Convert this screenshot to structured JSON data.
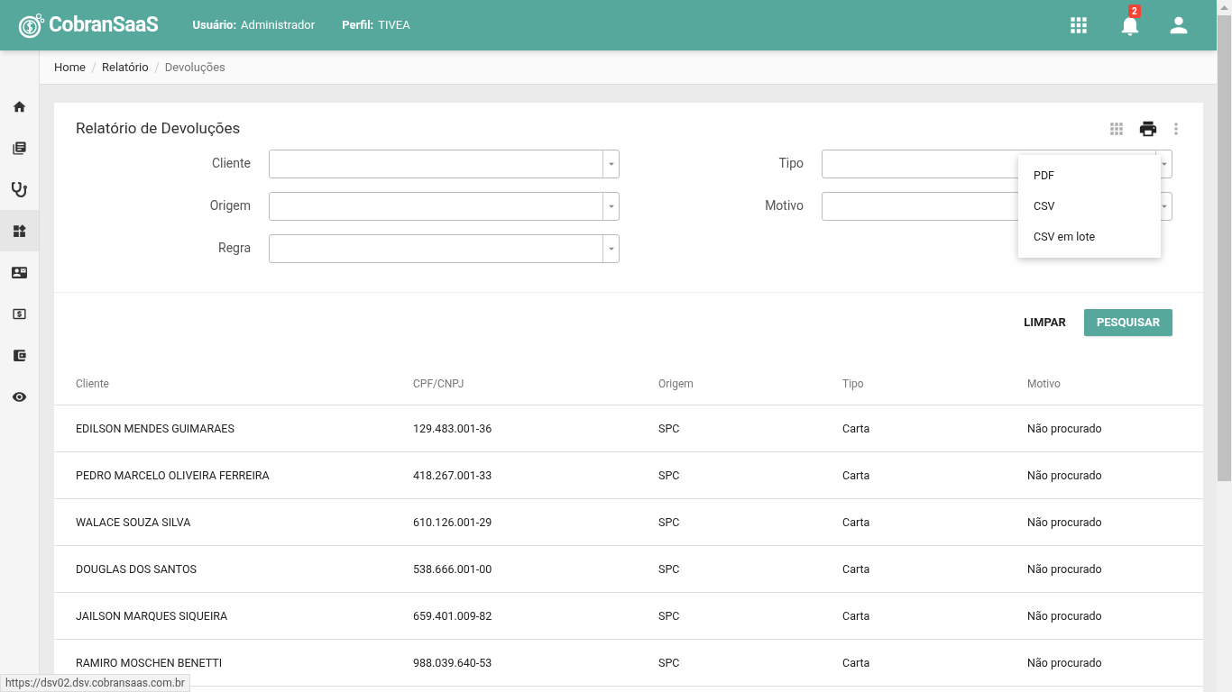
{
  "header": {
    "logo": "CobranSaaS",
    "user_label": "Usuário:",
    "user": "Administrador",
    "profile_label": "Perfil:",
    "profile": "TIVEA",
    "notifications": "2"
  },
  "sidebar": {
    "items": [
      {
        "selected": false
      },
      {
        "selected": false
      },
      {
        "selected": false
      },
      {
        "selected": true
      },
      {
        "selected": false
      },
      {
        "selected": false
      },
      {
        "selected": false
      },
      {
        "selected": false
      }
    ]
  },
  "breadcrumb": [
    "Home",
    "Relatório",
    "Devoluções"
  ],
  "card": {
    "title": "Relatório de Devoluções",
    "filters_left": [
      {
        "label": "Cliente"
      },
      {
        "label": "Origem"
      },
      {
        "label": "Regra"
      }
    ],
    "filters_right": [
      {
        "label": "Tipo"
      },
      {
        "label": "Motivo"
      }
    ],
    "export_menu": [
      "PDF",
      "CSV",
      "CSV em lote"
    ],
    "buttons": {
      "clear": "LIMPAR",
      "search": "PESQUISAR"
    },
    "table": {
      "columns": [
        "Cliente",
        "CPF/CNPJ",
        "Origem",
        "Tipo",
        "Motivo"
      ],
      "rows": [
        [
          "EDILSON MENDES GUIMARAES",
          "129.483.001-36",
          "SPC",
          "Carta",
          "Não procurado"
        ],
        [
          "PEDRO MARCELO OLIVEIRA FERREIRA",
          "418.267.001-33",
          "SPC",
          "Carta",
          "Não procurado"
        ],
        [
          "WALACE SOUZA SILVA",
          "610.126.001-29",
          "SPC",
          "Carta",
          "Não procurado"
        ],
        [
          "DOUGLAS DOS SANTOS",
          "538.666.001-00",
          "SPC",
          "Carta",
          "Não procurado"
        ],
        [
          "JAILSON MARQUES SIQUEIRA",
          "659.401.009-82",
          "SPC",
          "Carta",
          "Não procurado"
        ],
        [
          "RAMIRO MOSCHEN BENETTI",
          "988.039.640-53",
          "SPC",
          "Carta",
          "Não procurado"
        ]
      ]
    }
  },
  "status_url": "https://dsv02.dsv.cobransaas.com.br"
}
